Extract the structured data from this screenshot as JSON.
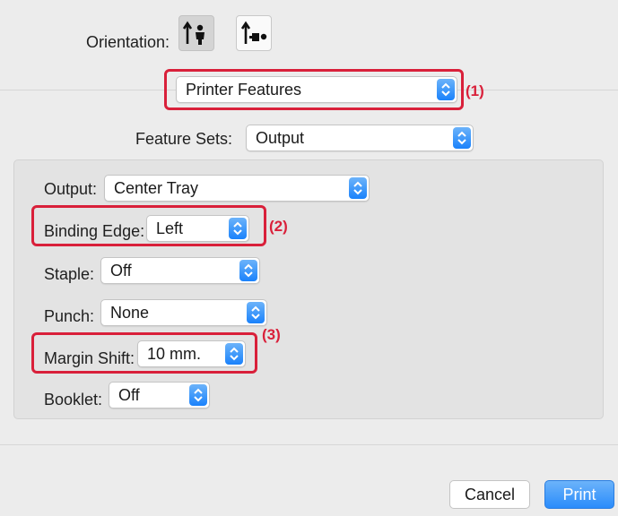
{
  "orientation": {
    "label": "Orientation:",
    "options": [
      "portrait-icon",
      "landscape-icon"
    ],
    "selected": "portrait"
  },
  "panel_select": {
    "value": "Printer Features"
  },
  "feature_sets": {
    "label": "Feature Sets:",
    "value": "Output"
  },
  "fields": {
    "output": {
      "label": "Output:",
      "value": "Center Tray"
    },
    "binding_edge": {
      "label": "Binding Edge:",
      "value": "Left"
    },
    "staple": {
      "label": "Staple:",
      "value": "Off"
    },
    "punch": {
      "label": "Punch:",
      "value": "None"
    },
    "margin_shift": {
      "label": "Margin Shift:",
      "value": "10 mm."
    },
    "booklet": {
      "label": "Booklet:",
      "value": "Off"
    }
  },
  "callouts": {
    "one": "(1)",
    "two": "(2)",
    "three": "(3)"
  },
  "buttons": {
    "cancel": "Cancel",
    "print": "Print"
  },
  "colors": {
    "callout": "#d9203a",
    "accent": "#1a82fb",
    "background": "#ececec"
  }
}
